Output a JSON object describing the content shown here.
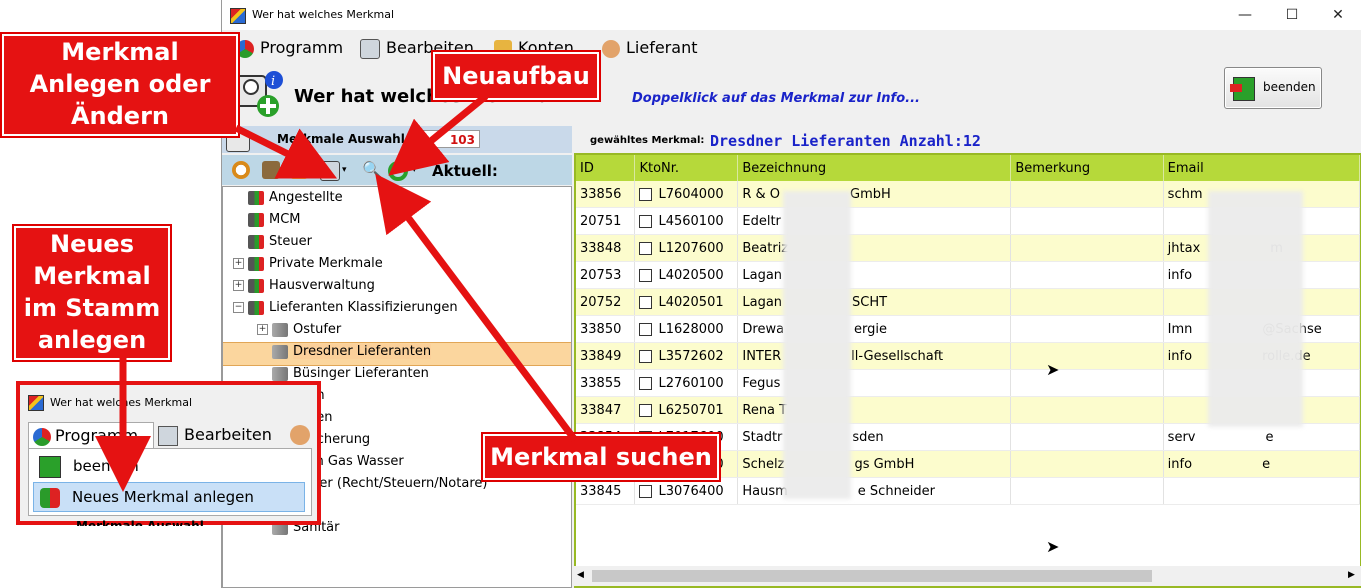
{
  "window": {
    "title": "Wer hat welches Merkmal",
    "min": "—",
    "max": "☐",
    "close": "✕"
  },
  "menu": [
    "Programm",
    "Bearbeiten",
    "Konten",
    "Lieferant"
  ],
  "header": {
    "title": "Wer hat welches Merkmal!!",
    "hint": "Doppelklick auf das Merkmal zur Info...",
    "end_button": "beenden"
  },
  "left": {
    "title": "Merkmale Auswahl",
    "count": "103",
    "aktuell_label": "Aktuell:"
  },
  "tree": [
    {
      "label": "Angestellte",
      "level": 0,
      "expander": ""
    },
    {
      "label": "MCM",
      "level": 0,
      "expander": ""
    },
    {
      "label": "Steuer",
      "level": 0,
      "expander": ""
    },
    {
      "label": "Private Merkmale",
      "level": 0,
      "expander": "+"
    },
    {
      "label": "Hausverwaltung",
      "level": 0,
      "expander": "+"
    },
    {
      "label": "Lieferanten Klassifizierungen",
      "level": 0,
      "expander": "−"
    },
    {
      "label": "Ostufer",
      "level": 1,
      "expander": "+"
    },
    {
      "label": "Dresdner Lieferanten",
      "level": 1,
      "expander": "",
      "selected": true
    },
    {
      "label": "Büsinger Lieferanten",
      "level": 1,
      "expander": ""
    },
    {
      "label": "chen",
      "level": 1,
      "expander": ""
    },
    {
      "label": "anken",
      "level": 1,
      "expander": ""
    },
    {
      "label": "ersicherung",
      "level": 1,
      "expander": ""
    },
    {
      "label": "trom Gas Wasser",
      "level": 1,
      "expander": ""
    },
    {
      "label": "erater (Recht/Steuern/Notare)",
      "level": 1,
      "expander": ""
    },
    {
      "label": "otar",
      "level": 1,
      "expander": ""
    },
    {
      "label": "Sanitär",
      "level": 1,
      "expander": ""
    }
  ],
  "grid": {
    "selected_label": "gewähltes Merkmal:",
    "selected_value": "Dresdner Lieferanten Anzahl:12",
    "columns": [
      "ID",
      "KtoNr.",
      "Bezeichnung",
      "Bemerkung",
      "Email"
    ],
    "rows": [
      {
        "id": "33856",
        "kto": "L7604000",
        "bez": "R & O",
        "bez2": "GmbH",
        "bem": "",
        "email": "schm",
        "email2": ""
      },
      {
        "id": "20751",
        "kto": "L4560100",
        "bez": "Edeltr",
        "bez2": "",
        "bem": "",
        "email": "",
        "email2": ""
      },
      {
        "id": "33848",
        "kto": "L1207600",
        "bez": "Beatriz",
        "bez2": "",
        "bem": "",
        "email": "jhtax",
        "email2": "m"
      },
      {
        "id": "20753",
        "kto": "L4020500",
        "bez": "Lagan",
        "bez2": "",
        "bem": "",
        "email": "info",
        "email2": ""
      },
      {
        "id": "20752",
        "kto": "L4020501",
        "bez": "Lagan",
        "bez2": "SCHT",
        "bem": "",
        "email": "",
        "email2": ""
      },
      {
        "id": "33850",
        "kto": "L1628000",
        "bez": "Drewa",
        "bez2": "ergie",
        "bem": "",
        "email": "Imn",
        "email2": "@Sachse"
      },
      {
        "id": "33849",
        "kto": "L3572602",
        "bez": "INTER",
        "bez2": "ll-Gesellschaft",
        "bem": "",
        "email": "info",
        "email2": "rolle.de"
      },
      {
        "id": "33855",
        "kto": "L2760100",
        "bez": "Fegus",
        "bez2": "",
        "bem": "",
        "email": "",
        "email2": ""
      },
      {
        "id": "33847",
        "kto": "L6250701",
        "bez": "Rena T",
        "bez2": "",
        "bem": "",
        "email": "",
        "email2": ""
      },
      {
        "id": "33854",
        "kto": "L7017600",
        "bez": "Stadtr",
        "bez2": "sden",
        "bem": "",
        "email": "serv",
        "email2": "e"
      },
      {
        "id": "33853",
        "kto": "L7400000",
        "bez": "Schelz",
        "bez2": "gs GmbH",
        "bem": "",
        "email": "info",
        "email2": "e"
      },
      {
        "id": "33845",
        "kto": "L3076400",
        "bez": "Hausm",
        "bez2": "e Schneider",
        "bem": "",
        "email": "",
        "email2": ""
      }
    ]
  },
  "callouts": {
    "anlegen": "Merkmal Anlegen oder Ändern",
    "neuaufbau": "Neuaufbau",
    "neues": "Neues Merkmal im Stamm anlegen",
    "suchen": "Merkmal suchen"
  },
  "inset": {
    "title": "Wer hat welches Merkmal",
    "menu_programm": "Programm",
    "menu_bearbeiten": "Bearbeiten",
    "item_beenden": "beenden",
    "item_neu": "Neues Merkmal anlegen",
    "footer": "Merkmale Auswahl"
  },
  "colors": {
    "callout": "#e51212",
    "grid_header": "#b6d93a",
    "row_alt": "#fcfccd",
    "hint": "#1a23c9"
  }
}
